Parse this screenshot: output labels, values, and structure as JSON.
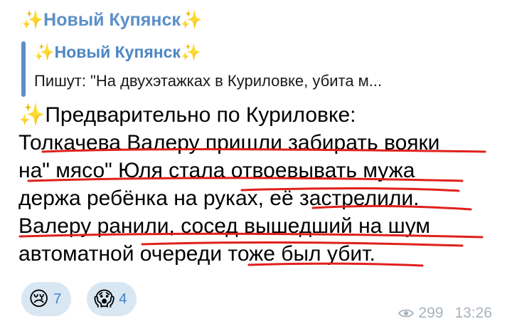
{
  "channel": {
    "sparkle": "✨",
    "name": "Новый Купянск"
  },
  "reply": {
    "title": "Новый Купянск",
    "preview": "Пишут: \"На двухэтажках в Куриловке, убита м..."
  },
  "message": {
    "lines": [
      "✨Предварительно по Куриловке:",
      "Толкачева Валеру пришли забирать вояки",
      "на\" мясо\" Юля стала отвоевывать мужа",
      "держа ребёнка на руках, её застрелили.",
      "Валеру ранили, сосед вышедший на шум",
      "автоматной очереди тоже был убит."
    ],
    "underline_color": "#e0201c"
  },
  "reactions": [
    {
      "emoji": "😢",
      "count": "7"
    },
    {
      "emoji": "😱",
      "count": "4"
    }
  ],
  "meta": {
    "views": "299",
    "time": "13:26",
    "icon": "eye-icon"
  },
  "colors": {
    "accent": "#5b8fc8",
    "reaction_bg": "#d9e7f3",
    "meta": "#a9b2bb"
  }
}
